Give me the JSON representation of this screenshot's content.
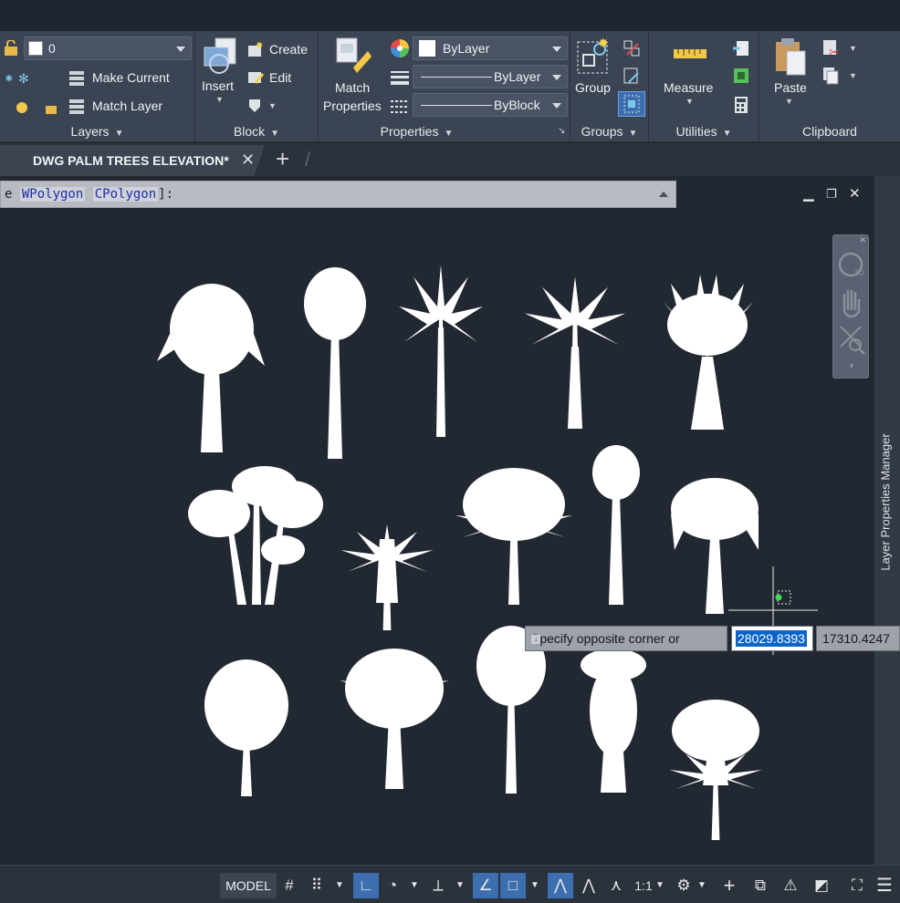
{
  "ribbon": {
    "layers": {
      "title": "Layers",
      "current_layer": "0",
      "make_current_label": "Make Current",
      "match_layer_label": "Match Layer"
    },
    "block": {
      "title": "Block",
      "insert_label": "Insert",
      "create_label": "Create",
      "edit_label": "Edit"
    },
    "properties": {
      "title": "Properties",
      "match_properties_line1": "Match",
      "match_properties_line2": "Properties",
      "color_value": "ByLayer",
      "linetype_value": "ByLayer",
      "lineweight_value": "ByBlock"
    },
    "groups": {
      "title": "Groups",
      "group_label": "Group"
    },
    "utilities": {
      "title": "Utilities",
      "measure_label": "Measure"
    },
    "clipboard": {
      "title": "Clipboard",
      "paste_label": "Paste"
    }
  },
  "tabs": {
    "active_tab": "DWG PALM TREES ELEVATION*"
  },
  "command_line": {
    "prefix": "e ",
    "option1": "WPolygon",
    "option2": "CPolygon",
    "suffix": "]:"
  },
  "sidebar": {
    "label": "Layer Properties Manager"
  },
  "dynamic_input": {
    "prompt": "Specify opposite corner or",
    "x_value": "28029.8393",
    "y_value": "17310.4247"
  },
  "statusbar": {
    "model_label": "MODEL",
    "scale_label": "1:1"
  },
  "colors": {
    "accent": "#3d6fb0",
    "canvas": "#222832",
    "ribbon": "#3b4453"
  }
}
